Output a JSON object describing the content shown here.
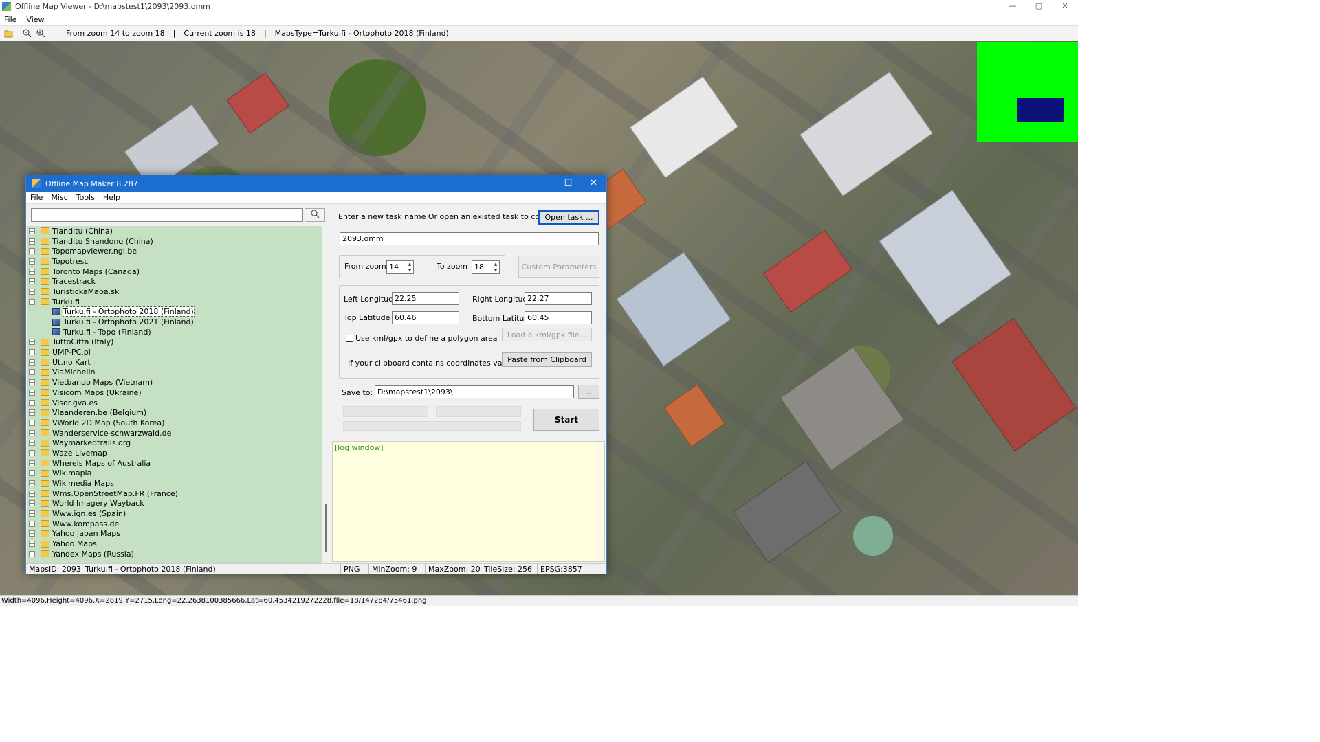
{
  "main_window": {
    "title": "Offline Map Viewer - D:\\mapstest1\\2093\\2093.omm",
    "window_buttons": [
      "—",
      "▢",
      "✕"
    ],
    "menu": [
      "File",
      "View"
    ],
    "toolbar_icons": [
      "open-folder-icon",
      "zoom-out-icon",
      "zoom-in-icon"
    ],
    "toolbar_info": {
      "zoom_range": "From zoom 14 to zoom 18",
      "current_zoom": "Current zoom is 18",
      "maps_type": "MapsType=Turku.fi - Ortophoto 2018 (Finland)",
      "sep": "|"
    },
    "status": "Width=4096,Height=4096,X=2819,Y=2715,Long=22.2638100385666,Lat=60.4534219272228,file=18/147284/75461.png",
    "minimap_colors": {
      "background": "#00ff00",
      "viewport": "#0a1478"
    }
  },
  "dialog": {
    "title": "Offline Map Maker 8.287",
    "window_buttons": [
      "—",
      "☐",
      "✕"
    ],
    "menu": [
      "File",
      "Misc",
      "Tools",
      "Help"
    ],
    "search": {
      "value": "",
      "icon": "search-icon"
    },
    "tree": [
      {
        "label": "Tianditu (China)",
        "type": "folder",
        "expanded": false
      },
      {
        "label": "Tianditu Shandong (China)",
        "type": "folder",
        "expanded": false
      },
      {
        "label": "Topomapviewer.ngi.be",
        "type": "folder",
        "expanded": false
      },
      {
        "label": "Topotresc",
        "type": "folder",
        "expanded": false
      },
      {
        "label": "Toronto Maps (Canada)",
        "type": "folder",
        "expanded": false
      },
      {
        "label": "Tracestrack",
        "type": "folder",
        "expanded": false
      },
      {
        "label": "TuristickaMapa.sk",
        "type": "folder",
        "expanded": false
      },
      {
        "label": "Turku.fi",
        "type": "folder",
        "expanded": true
      },
      {
        "label": "Turku.fi - Ortophoto 2018 (Finland)",
        "type": "map",
        "selected": true
      },
      {
        "label": "Turku.fi - Ortophoto 2021 (Finland)",
        "type": "map"
      },
      {
        "label": "Turku.fi - Topo (Finland)",
        "type": "map"
      },
      {
        "label": "TuttoCitta (Italy)",
        "type": "folder",
        "expanded": false
      },
      {
        "label": "UMP-PC.pl",
        "type": "folder",
        "expanded": false
      },
      {
        "label": "Ut.no Kart",
        "type": "folder",
        "expanded": false
      },
      {
        "label": "ViaMichelin",
        "type": "folder",
        "expanded": false
      },
      {
        "label": "Vietbando Maps (Vietnam)",
        "type": "folder",
        "expanded": false
      },
      {
        "label": "Visicom Maps (Ukraine)",
        "type": "folder",
        "expanded": false
      },
      {
        "label": "Visor.gva.es",
        "type": "folder",
        "expanded": false
      },
      {
        "label": "Vlaanderen.be (Belgium)",
        "type": "folder",
        "expanded": false
      },
      {
        "label": "VWorld 2D Map (South Korea)",
        "type": "folder",
        "expanded": false
      },
      {
        "label": "Wanderservice-schwarzwald.de",
        "type": "folder",
        "expanded": false
      },
      {
        "label": "Waymarkedtrails.org",
        "type": "folder",
        "expanded": false
      },
      {
        "label": "Waze Livemap",
        "type": "folder",
        "expanded": false
      },
      {
        "label": "Whereis Maps of Australia",
        "type": "folder",
        "expanded": false
      },
      {
        "label": "Wikimapia",
        "type": "folder",
        "expanded": false
      },
      {
        "label": "Wikimedia Maps",
        "type": "folder",
        "expanded": false
      },
      {
        "label": "Wms.OpenStreetMap.FR (France)",
        "type": "folder",
        "expanded": false
      },
      {
        "label": "World Imagery Wayback",
        "type": "folder",
        "expanded": false
      },
      {
        "label": "Www.ign.es (Spain)",
        "type": "folder",
        "expanded": false
      },
      {
        "label": "Www.kompass.de",
        "type": "folder",
        "expanded": false
      },
      {
        "label": "Yahoo Japan Maps",
        "type": "folder",
        "expanded": false
      },
      {
        "label": "Yahoo Maps",
        "type": "folder",
        "expanded": false
      },
      {
        "label": "Yandex Maps (Russia)",
        "type": "folder",
        "expanded": false
      }
    ],
    "task_prompt": "Enter a new task name Or open an existed task to continue:",
    "open_task_label": "Open task ...",
    "task_name": "2093.omm",
    "from_zoom_label": "From zoom",
    "from_zoom": "14",
    "to_zoom_label": "To zoom",
    "to_zoom": "18",
    "custom_params_label": "Custom Parameters",
    "left_lon_label": "Left Longitude",
    "left_lon": "22.25",
    "right_lon_label": "Right Longitude",
    "right_lon": "22.27",
    "top_lat_label": "Top Latitude",
    "top_lat": "60.46",
    "bottom_lat_label": "Bottom Latitude",
    "bottom_lat": "60.45",
    "kml_label": "Use kml/gpx to define a polygon area",
    "kml_checked": false,
    "load_kml_label": "Load a kml/gpx file...",
    "clipboard_prompt": "If your clipboard contains coordinates values:",
    "paste_label": "Paste from Clipboard",
    "save_to_label": "Save to:",
    "save_to": "D:\\mapstest1\\2093\\",
    "browse_label": "...",
    "start_label": "Start",
    "log_text": "[log window]",
    "status": {
      "maps_id": "MapsID: 2093",
      "map_name": "Turku.fi - Ortophoto 2018 (Finland)",
      "format": "PNG",
      "min_zoom": "MinZoom: 9",
      "max_zoom": "MaxZoom: 20",
      "tile_size": "TileSize: 256",
      "epsg": "EPSG:3857"
    }
  }
}
